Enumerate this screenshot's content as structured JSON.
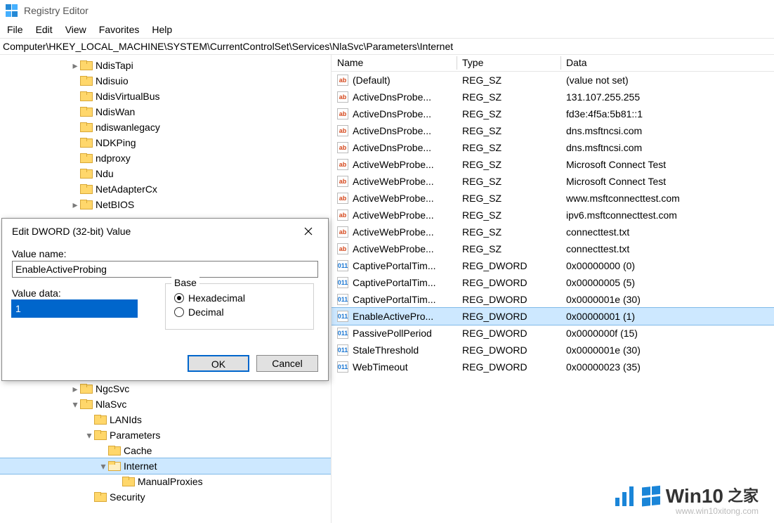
{
  "app": {
    "title": "Registry Editor"
  },
  "menu": [
    "File",
    "Edit",
    "View",
    "Favorites",
    "Help"
  ],
  "address": "Computer\\HKEY_LOCAL_MACHINE\\SYSTEM\\CurrentControlSet\\Services\\NlaSvc\\Parameters\\Internet",
  "tree": [
    {
      "indent": 5,
      "chev": "closed",
      "label": "NdisTapi"
    },
    {
      "indent": 5,
      "chev": "none",
      "label": "Ndisuio"
    },
    {
      "indent": 5,
      "chev": "none",
      "label": "NdisVirtualBus"
    },
    {
      "indent": 5,
      "chev": "none",
      "label": "NdisWan"
    },
    {
      "indent": 5,
      "chev": "none",
      "label": "ndiswanlegacy"
    },
    {
      "indent": 5,
      "chev": "none",
      "label": "NDKPing"
    },
    {
      "indent": 5,
      "chev": "none",
      "label": "ndproxy"
    },
    {
      "indent": 5,
      "chev": "none",
      "label": "Ndu"
    },
    {
      "indent": 5,
      "chev": "none",
      "label": "NetAdapterCx"
    },
    {
      "indent": 5,
      "chev": "closed",
      "label": "NetBIOS"
    },
    {
      "indent": 5,
      "chev": "closed",
      "label": "NgcSvc"
    },
    {
      "indent": 5,
      "chev": "open",
      "label": "NlaSvc"
    },
    {
      "indent": 6,
      "chev": "none",
      "label": "LANIds"
    },
    {
      "indent": 6,
      "chev": "open",
      "label": "Parameters"
    },
    {
      "indent": 7,
      "chev": "none",
      "label": "Cache"
    },
    {
      "indent": 7,
      "chev": "open",
      "label": "Internet",
      "selected": true
    },
    {
      "indent": 8,
      "chev": "none",
      "label": "ManualProxies"
    },
    {
      "indent": 6,
      "chev": "none",
      "label": "Security"
    }
  ],
  "columns": {
    "name": "Name",
    "type": "Type",
    "data": "Data"
  },
  "rows": [
    {
      "icon": "sz",
      "name": "(Default)",
      "type": "REG_SZ",
      "data": "(value not set)"
    },
    {
      "icon": "sz",
      "name": "ActiveDnsProbe...",
      "type": "REG_SZ",
      "data": "131.107.255.255"
    },
    {
      "icon": "sz",
      "name": "ActiveDnsProbe...",
      "type": "REG_SZ",
      "data": "fd3e:4f5a:5b81::1"
    },
    {
      "icon": "sz",
      "name": "ActiveDnsProbe...",
      "type": "REG_SZ",
      "data": "dns.msftncsi.com"
    },
    {
      "icon": "sz",
      "name": "ActiveDnsProbe...",
      "type": "REG_SZ",
      "data": "dns.msftncsi.com"
    },
    {
      "icon": "sz",
      "name": "ActiveWebProbe...",
      "type": "REG_SZ",
      "data": "Microsoft Connect Test"
    },
    {
      "icon": "sz",
      "name": "ActiveWebProbe...",
      "type": "REG_SZ",
      "data": "Microsoft Connect Test"
    },
    {
      "icon": "sz",
      "name": "ActiveWebProbe...",
      "type": "REG_SZ",
      "data": "www.msftconnecttest.com"
    },
    {
      "icon": "sz",
      "name": "ActiveWebProbe...",
      "type": "REG_SZ",
      "data": "ipv6.msftconnecttest.com"
    },
    {
      "icon": "sz",
      "name": "ActiveWebProbe...",
      "type": "REG_SZ",
      "data": "connecttest.txt"
    },
    {
      "icon": "sz",
      "name": "ActiveWebProbe...",
      "type": "REG_SZ",
      "data": "connecttest.txt"
    },
    {
      "icon": "dw",
      "name": "CaptivePortalTim...",
      "type": "REG_DWORD",
      "data": "0x00000000 (0)"
    },
    {
      "icon": "dw",
      "name": "CaptivePortalTim...",
      "type": "REG_DWORD",
      "data": "0x00000005 (5)"
    },
    {
      "icon": "dw",
      "name": "CaptivePortalTim...",
      "type": "REG_DWORD",
      "data": "0x0000001e (30)"
    },
    {
      "icon": "dw",
      "name": "EnableActivePro...",
      "type": "REG_DWORD",
      "data": "0x00000001 (1)",
      "selected": true
    },
    {
      "icon": "dw",
      "name": "PassivePollPeriod",
      "type": "REG_DWORD",
      "data": "0x0000000f (15)"
    },
    {
      "icon": "dw",
      "name": "StaleThreshold",
      "type": "REG_DWORD",
      "data": "0x0000001e (30)"
    },
    {
      "icon": "dw",
      "name": "WebTimeout",
      "type": "REG_DWORD",
      "data": "0x00000023 (35)"
    }
  ],
  "dialog": {
    "title": "Edit DWORD (32-bit) Value",
    "value_name_label": "Value name:",
    "value_name": "EnableActiveProbing",
    "value_data_label": "Value data:",
    "value_data": "1",
    "base_label": "Base",
    "hex_label": "Hexadecimal",
    "dec_label": "Decimal",
    "ok": "OK",
    "cancel": "Cancel"
  },
  "watermark": {
    "brand1": "Win10",
    "brand2": "之家",
    "url": "www.win10xitong.com"
  }
}
